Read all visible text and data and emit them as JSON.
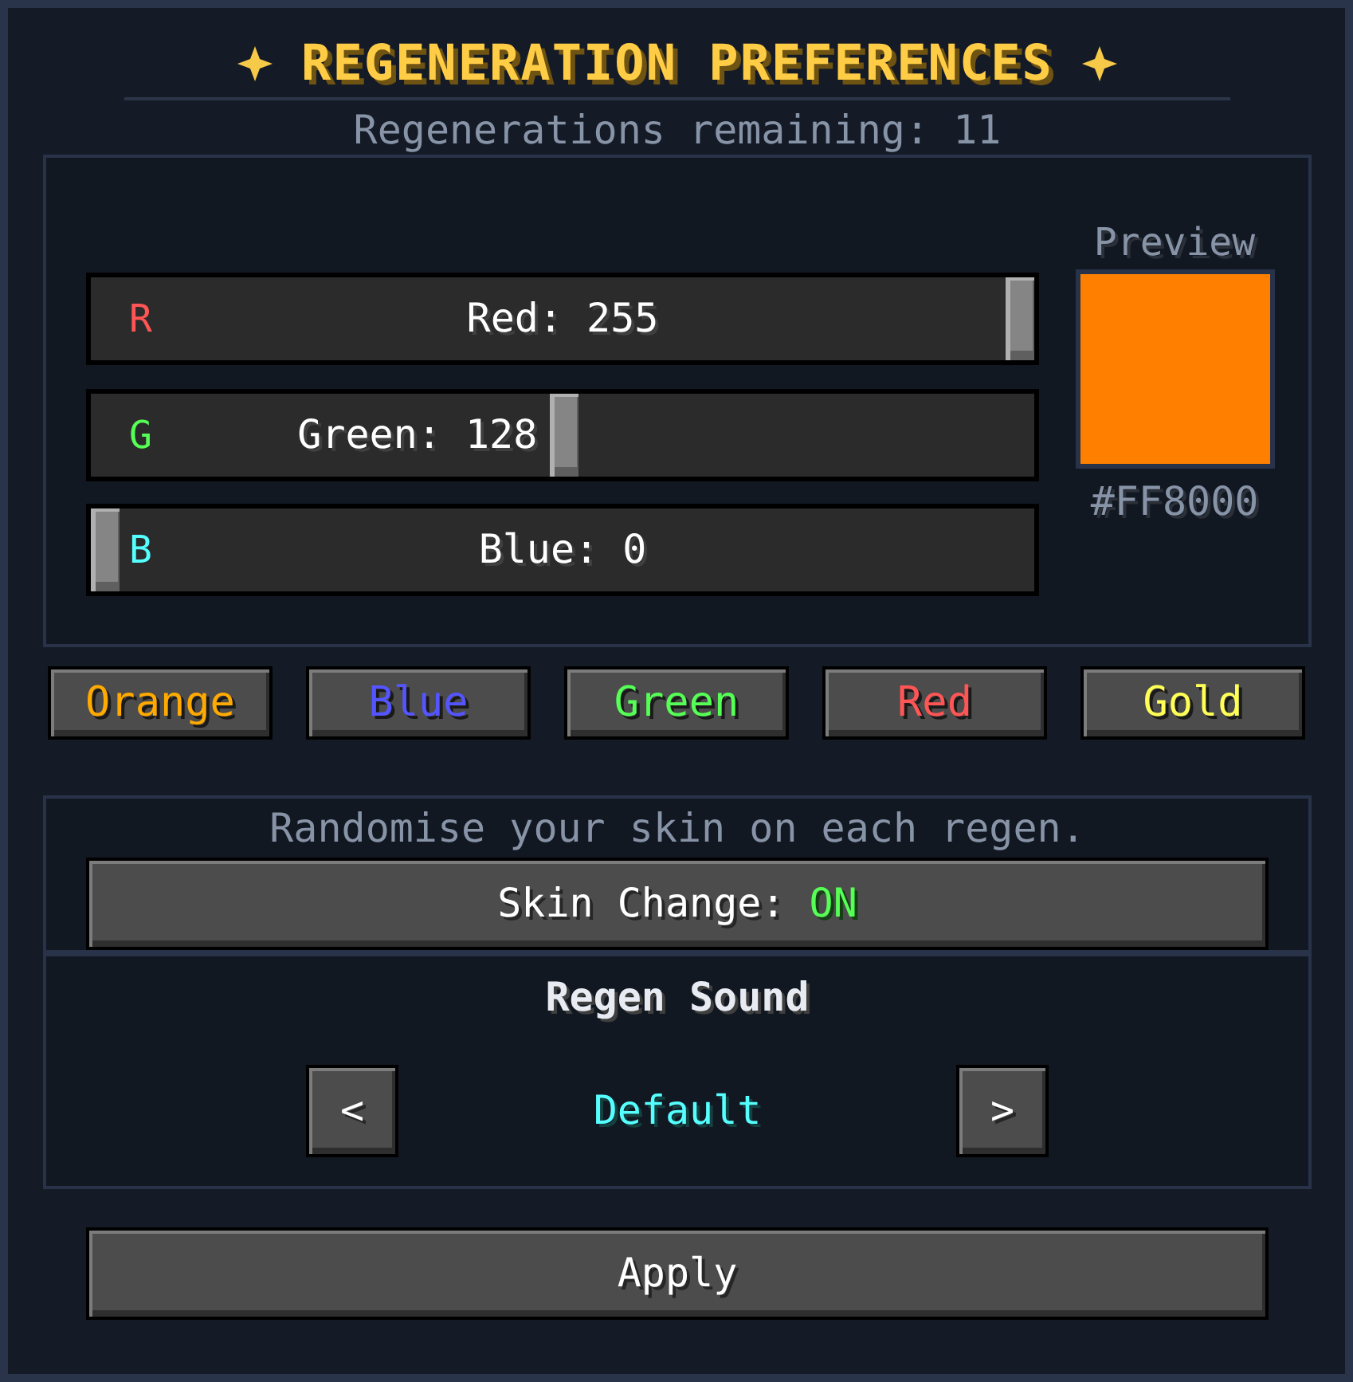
{
  "window": {
    "title": "REGENERATION PREFERENCES",
    "subtitle": "Regenerations remaining: 11"
  },
  "color_picker": {
    "sliders": [
      {
        "letter": "R",
        "label": "Red: 255",
        "level": 1,
        "color": "#ff5555"
      },
      {
        "letter": "G",
        "label": "Green: 128",
        "level": 0.502,
        "color": "#55ff55"
      },
      {
        "letter": "B",
        "label": "Blue: 0",
        "level": 0,
        "color": "#55ffff"
      }
    ],
    "preview": {
      "label": "Preview",
      "color": "#ff8000",
      "hex": "#FF8000"
    }
  },
  "presets": [
    {
      "label": "Orange",
      "color": "#ffaa00"
    },
    {
      "label": "Blue",
      "color": "#5555ff"
    },
    {
      "label": "Green",
      "color": "#55ff55"
    },
    {
      "label": "Red",
      "color": "#ff5555"
    },
    {
      "label": "Gold",
      "color": "#ffff55"
    }
  ],
  "skin_change": {
    "caption": "Randomise your skin on each regen.",
    "label": "Skin Change:",
    "value": "ON",
    "on": true
  },
  "sound": {
    "title": "Regen Sound",
    "prev_label": "<",
    "value": "Default",
    "next_label": ">"
  },
  "apply_button": "Apply"
}
